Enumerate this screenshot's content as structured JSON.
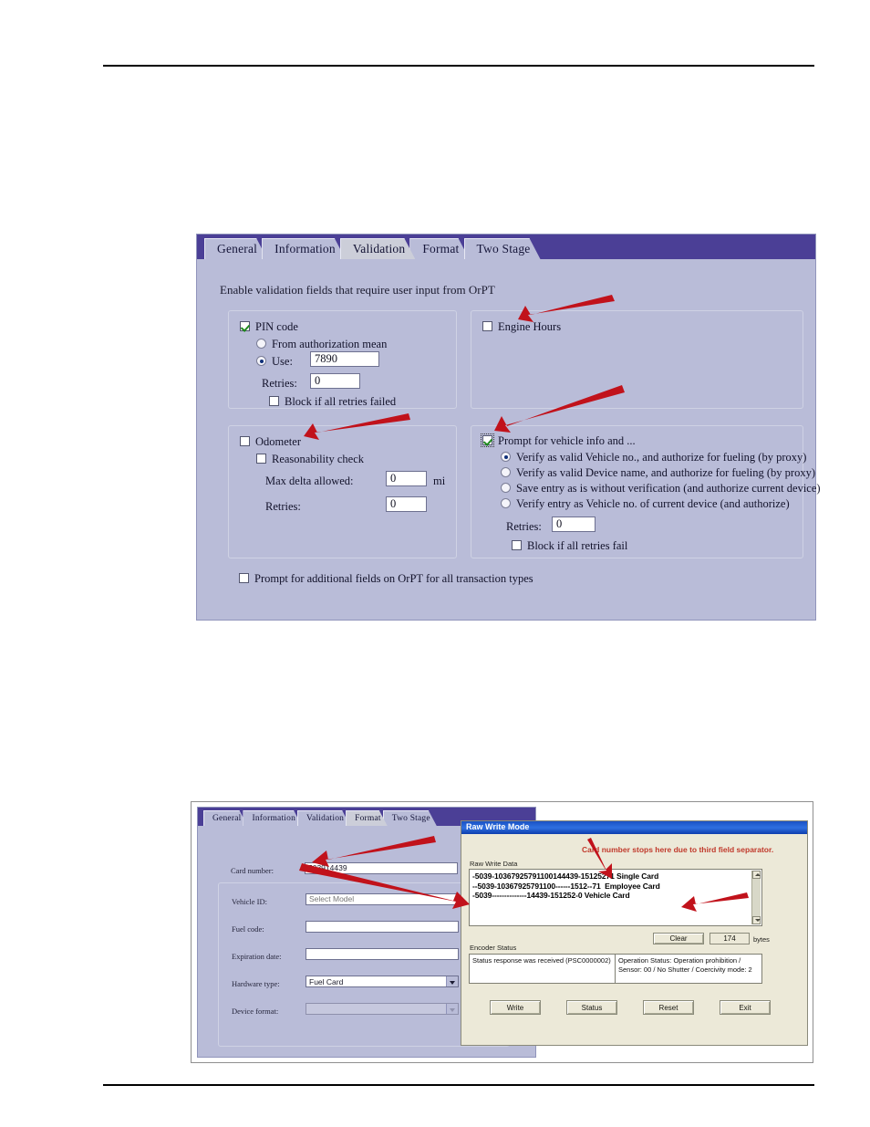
{
  "figure1": {
    "tabs": [
      {
        "label": "General",
        "active": false
      },
      {
        "label": "Information",
        "active": false
      },
      {
        "label": "Validation",
        "active": true
      },
      {
        "label": "Format",
        "active": false
      },
      {
        "label": "Two Stage",
        "active": false
      }
    ],
    "hint": "Enable validation fields that require user input from OrPT",
    "pin_group": {
      "title": "PIN code",
      "checked": true,
      "radio_from_auth": "From authorization mean",
      "radio_use": "Use:",
      "use_value": "7890",
      "retries_label": "Retries:",
      "retries_value": "0",
      "block_label": "Block if all retries failed",
      "block_checked": false
    },
    "engine_group": {
      "title": "Engine Hours",
      "checked": false
    },
    "odometer_group": {
      "title": "Odometer",
      "checked": false,
      "reasonability_label": "Reasonability check",
      "reasonability_checked": false,
      "max_delta_label": "Max delta allowed:",
      "max_delta_value": "0",
      "max_delta_unit": "mi",
      "retries_label": "Retries:",
      "retries_value": "0"
    },
    "vehicle_group": {
      "title": "Prompt for vehicle info and ...",
      "checked": true,
      "options": [
        "Verify as valid Vehicle no., and authorize for fueling (by proxy)",
        "Verify as valid Device name, and authorize for fueling (by proxy)",
        "Save entry as is without verification (and authorize current device)",
        "Verify entry as Vehicle no. of current device (and authorize)"
      ],
      "selected_index": 0,
      "retries_label": "Retries:",
      "retries_value": "0",
      "block_label": "Block if all retries fail",
      "block_checked": false
    },
    "footer_checkbox": {
      "label": "Prompt for additional fields on OrPT for all transaction types",
      "checked": false
    }
  },
  "figure2": {
    "tabs": [
      {
        "label": "General",
        "active": false
      },
      {
        "label": "Information",
        "active": false
      },
      {
        "label": "Validation",
        "active": false
      },
      {
        "label": "Format",
        "active": true
      },
      {
        "label": "Two Stage",
        "active": false
      }
    ],
    "fields": {
      "card_number_label": "Card number:",
      "card_number_value": "503914439",
      "vehicle_id_label": "Vehicle ID:",
      "vehicle_id_placeholder": "Select Model",
      "fuel_code_label": "Fuel code:",
      "fuel_code_value": "",
      "expiration_label": "Expiration date:",
      "expiration_value": "",
      "hardware_type_label": "Hardware type:",
      "hardware_type_value": "Fuel Card",
      "device_format_label": "Device format:",
      "device_format_value": ""
    },
    "raw_write": {
      "title": "Raw Write Mode",
      "annotation": "Card number stops here due to third field separator.",
      "data_label": "Raw Write Data",
      "lines": [
        "-5039-10367925791100144439-15125271 Single Card",
        "--5039-10367925791100------1512--71  Employee Card",
        "-5039--------------14439-151252-0 Vehicle Card"
      ],
      "clear_label": "Clear",
      "bytes_value": "174",
      "bytes_label": "bytes",
      "encoder_status_label": "Encoder Status",
      "status_left": "Status response was received (PSC0000002)",
      "status_right": "Operation Status: Operation prohibition / Sensor: 00 / No Shutter / Coercivity mode: 2",
      "buttons": [
        "Write",
        "Status",
        "Reset",
        "Exit"
      ]
    }
  },
  "colors": {
    "tab_bar": "#4b3f96",
    "panel": "#b9bcd8",
    "arrow_red": "#c1121b",
    "dialog_bg": "#ece9d8",
    "title_blue": "#1a52c4"
  }
}
